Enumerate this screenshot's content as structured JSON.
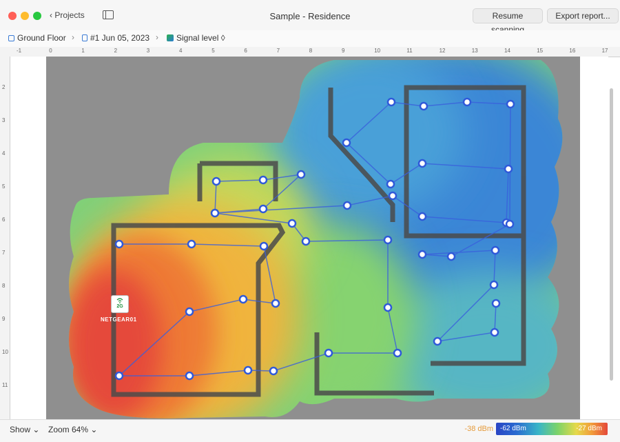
{
  "window": {
    "title": "Sample - Residence",
    "back_label": "Projects",
    "resume_label": "Resume scanning",
    "export_label": "Export report..."
  },
  "breadcrumb": {
    "floor": "Ground Floor",
    "scan": "#1 Jun 05, 2023",
    "view": "Signal level",
    "view_suffix": "◊"
  },
  "ruler": {
    "h_ticks": [
      "-1",
      "0",
      "1",
      "2",
      "3",
      "4",
      "5",
      "6",
      "7",
      "8",
      "9",
      "10",
      "11",
      "12",
      "13",
      "14",
      "15",
      "16",
      "17"
    ],
    "v_ticks": [
      "2",
      "3",
      "4",
      "5",
      "6",
      "7",
      "8",
      "9",
      "10",
      "11"
    ]
  },
  "router": {
    "name": "NETGEAR01",
    "band": "2G"
  },
  "bottom": {
    "show_label": "Show",
    "show_caret": "⌄",
    "zoom_label": "Zoom 64%",
    "zoom_caret": "⌄",
    "legend_left": "-38 dBm",
    "legend_mid": "-62 dBm",
    "legend_right": "-27 dBm"
  },
  "colors": {
    "weak": "#2a45c4",
    "medium": "#7bd36a",
    "strong": "#e4483a",
    "measure_point": "#2f59d9"
  }
}
